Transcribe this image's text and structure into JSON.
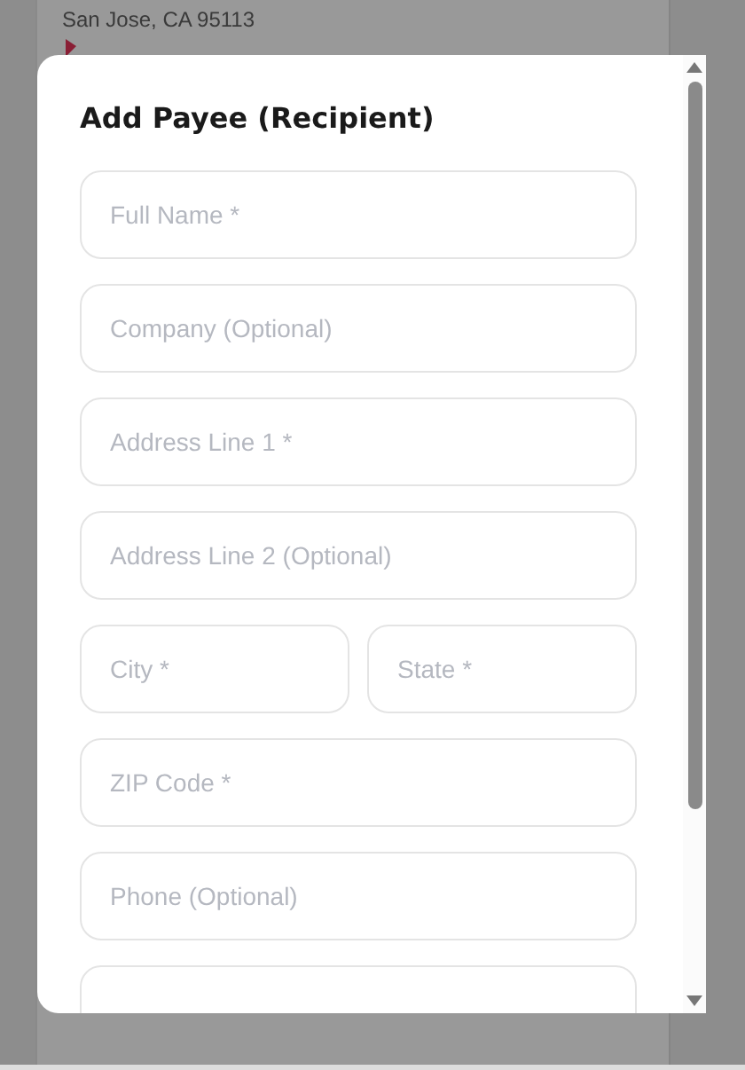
{
  "background_card": {
    "address_line": "San Jose, CA 95113"
  },
  "dialog": {
    "title": "Add Payee (Recipient)",
    "field_rows": [
      [
        {
          "placeholder": "Full Name *"
        }
      ],
      [
        {
          "placeholder": "Company (Optional)"
        }
      ],
      [
        {
          "placeholder": "Address Line 1 *"
        }
      ],
      [
        {
          "placeholder": "Address Line 2 (Optional)"
        }
      ],
      [
        {
          "placeholder": "City *"
        },
        {
          "placeholder": "State *"
        }
      ],
      [
        {
          "placeholder": "ZIP Code *"
        }
      ],
      [
        {
          "placeholder": "Phone (Optional)"
        }
      ],
      [
        {}
      ]
    ]
  }
}
